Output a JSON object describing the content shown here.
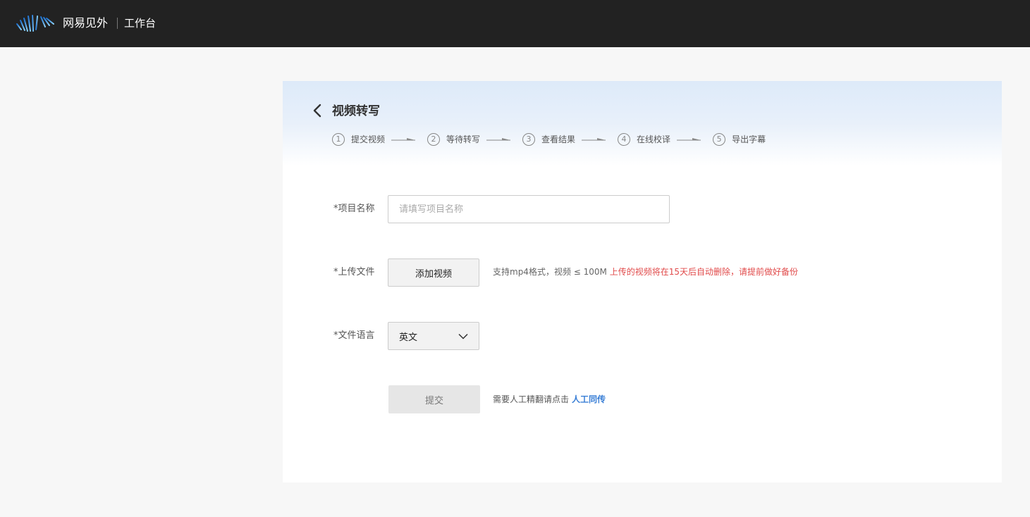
{
  "header": {
    "brand": "网易见外",
    "subtitle": "工作台",
    "logo_icon": "waveform-logo-icon"
  },
  "page": {
    "title": "视频转写",
    "back_icon": "chevron-left-icon"
  },
  "steps": [
    {
      "num": "1",
      "label": "提交视频"
    },
    {
      "num": "2",
      "label": "等待转写"
    },
    {
      "num": "3",
      "label": "查看结果"
    },
    {
      "num": "4",
      "label": "在线校译"
    },
    {
      "num": "5",
      "label": "导出字幕"
    }
  ],
  "form": {
    "project_name": {
      "label": "*项目名称",
      "value": "",
      "placeholder": "请填写项目名称"
    },
    "upload": {
      "label": "*上传文件",
      "button": "添加视频",
      "hint": "支持mp4格式，视频 ≤ 100M",
      "warning": "上传的视频将在15天后自动删除，请提前做好备份"
    },
    "language": {
      "label": "*文件语言",
      "value": "英文"
    },
    "submit": {
      "button": "提交",
      "manual_hint": "需要人工精翻请点击",
      "manual_link": "人工同传"
    }
  },
  "colors": {
    "topbar": "#222222",
    "link": "#3a7fd6",
    "warning": "#e14b4b",
    "logo_gradient": [
      "#1a7fe0",
      "#4fc3f7"
    ]
  }
}
